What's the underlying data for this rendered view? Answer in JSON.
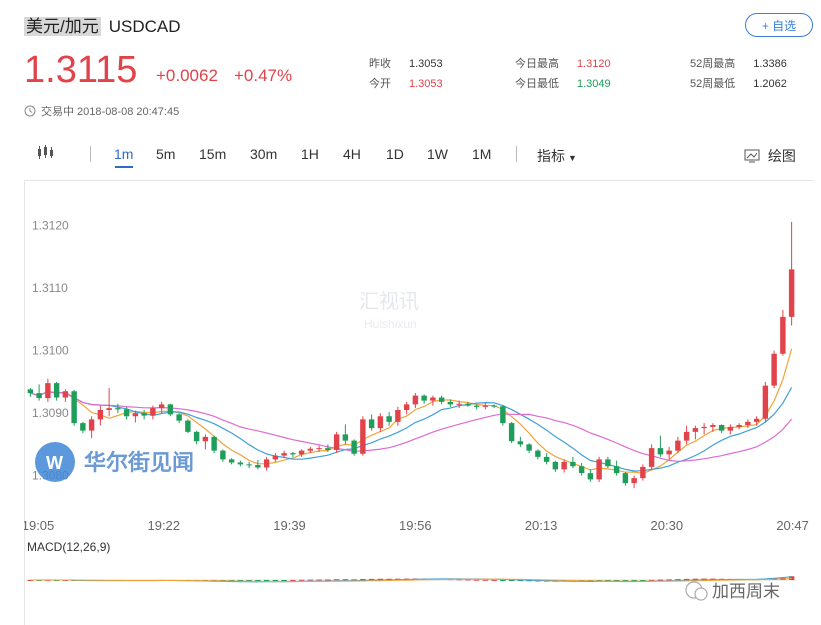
{
  "header": {
    "name_cn": "美元/加元",
    "symbol": "USDCAD",
    "add_button": "+ 自选",
    "price": "1.3115",
    "change": "+0.0062",
    "change_pct": "+0.47%",
    "status": "交易中 2018-08-08 20:47:45"
  },
  "stats": [
    {
      "label": "昨收",
      "value": "1.3053",
      "color": "dark"
    },
    {
      "label": "今开",
      "value": "1.3053",
      "color": "red"
    },
    {
      "label": "今日最高",
      "value": "1.3120",
      "color": "red"
    },
    {
      "label": "今日最低",
      "value": "1.3049",
      "color": "green"
    },
    {
      "label": "52周最高",
      "value": "1.3386",
      "color": "dark"
    },
    {
      "label": "52周最低",
      "value": "1.2062",
      "color": "dark"
    }
  ],
  "toolbar": {
    "tabs": [
      "1m",
      "5m",
      "15m",
      "30m",
      "1H",
      "4H",
      "1D",
      "1W",
      "1M"
    ],
    "active_tab": "1m",
    "indicator_label": "指标",
    "draw_label": "绘图"
  },
  "colors": {
    "up": "#e0434a",
    "down": "#1e9e5a",
    "accent": "#2f6bc2"
  },
  "chart_data": {
    "type": "candlestick",
    "y_ticks": [
      "1.3120",
      "1.3110",
      "1.3100",
      "1.3090",
      "1.3080"
    ],
    "ylim": [
      1.30745,
      1.31265
    ],
    "x_ticks": [
      "19:05",
      "19:22",
      "19:39",
      "19:56",
      "20:13",
      "20:30",
      "20:47"
    ],
    "candles": [
      [
        1.30938,
        1.3094,
        1.30926,
        1.30932
      ],
      [
        1.30932,
        1.30946,
        1.3092,
        1.30924
      ],
      [
        1.30924,
        1.30955,
        1.30918,
        1.30948
      ],
      [
        1.30948,
        1.3095,
        1.3092,
        1.30925
      ],
      [
        1.30925,
        1.30938,
        1.30918,
        1.30935
      ],
      [
        1.30935,
        1.30937,
        1.3088,
        1.30884
      ],
      [
        1.30884,
        1.30886,
        1.30868,
        1.30872
      ],
      [
        1.30872,
        1.30895,
        1.3086,
        1.3089
      ],
      [
        1.3089,
        1.30912,
        1.3088,
        1.30905
      ],
      [
        1.30905,
        1.3094,
        1.30895,
        1.30908
      ],
      [
        1.30908,
        1.30915,
        1.309,
        1.30906
      ],
      [
        1.30906,
        1.3091,
        1.3089,
        1.30895
      ],
      [
        1.30895,
        1.30904,
        1.30885,
        1.309
      ],
      [
        1.309,
        1.30905,
        1.3089,
        1.30896
      ],
      [
        1.30896,
        1.30912,
        1.3089,
        1.30908
      ],
      [
        1.30908,
        1.30918,
        1.309,
        1.30914
      ],
      [
        1.30914,
        1.30915,
        1.30895,
        1.30898
      ],
      [
        1.30898,
        1.309,
        1.30884,
        1.30888
      ],
      [
        1.30888,
        1.3089,
        1.30868,
        1.3087
      ],
      [
        1.3087,
        1.30872,
        1.3085,
        1.30855
      ],
      [
        1.30855,
        1.30866,
        1.30842,
        1.30862
      ],
      [
        1.30862,
        1.30864,
        1.30836,
        1.3084
      ],
      [
        1.3084,
        1.30842,
        1.30822,
        1.30826
      ],
      [
        1.30826,
        1.30828,
        1.30818,
        1.30821
      ],
      [
        1.30821,
        1.30824,
        1.30815,
        1.30818
      ],
      [
        1.30818,
        1.30822,
        1.30812,
        1.30817
      ],
      [
        1.30817,
        1.30825,
        1.3081,
        1.30813
      ],
      [
        1.30813,
        1.3083,
        1.30808,
        1.30826
      ],
      [
        1.30826,
        1.30836,
        1.30822,
        1.30832
      ],
      [
        1.30832,
        1.3084,
        1.30828,
        1.30836
      ],
      [
        1.30836,
        1.30838,
        1.3083,
        1.30834
      ],
      [
        1.30834,
        1.30842,
        1.3083,
        1.3084
      ],
      [
        1.3084,
        1.30846,
        1.30836,
        1.30843
      ],
      [
        1.30843,
        1.30848,
        1.30838,
        1.30844
      ],
      [
        1.30844,
        1.3085,
        1.30838,
        1.30841
      ],
      [
        1.30841,
        1.3087,
        1.30836,
        1.30866
      ],
      [
        1.30866,
        1.30882,
        1.3085,
        1.30856
      ],
      [
        1.30856,
        1.30858,
        1.30832,
        1.30835
      ],
      [
        1.30835,
        1.30895,
        1.30832,
        1.3089
      ],
      [
        1.3089,
        1.30898,
        1.30872,
        1.30876
      ],
      [
        1.30876,
        1.309,
        1.3087,
        1.30895
      ],
      [
        1.30895,
        1.30902,
        1.3088,
        1.30886
      ],
      [
        1.30886,
        1.3091,
        1.3088,
        1.30905
      ],
      [
        1.30905,
        1.30918,
        1.30898,
        1.30914
      ],
      [
        1.30914,
        1.30932,
        1.30908,
        1.30928
      ],
      [
        1.30928,
        1.3093,
        1.30915,
        1.3092
      ],
      [
        1.3092,
        1.30928,
        1.30912,
        1.30925
      ],
      [
        1.30925,
        1.30928,
        1.30914,
        1.30918
      ],
      [
        1.30918,
        1.30922,
        1.3091,
        1.30914
      ],
      [
        1.30914,
        1.3092,
        1.30908,
        1.30915
      ],
      [
        1.30915,
        1.30918,
        1.3091,
        1.30912
      ],
      [
        1.30912,
        1.30914,
        1.30906,
        1.3091
      ],
      [
        1.3091,
        1.30916,
        1.30906,
        1.30912
      ],
      [
        1.30912,
        1.30914,
        1.30908,
        1.30911
      ],
      [
        1.30911,
        1.30912,
        1.3088,
        1.30884
      ],
      [
        1.30884,
        1.30886,
        1.30852,
        1.30855
      ],
      [
        1.30855,
        1.30862,
        1.30846,
        1.3085
      ],
      [
        1.3085,
        1.30852,
        1.30836,
        1.3084
      ],
      [
        1.3084,
        1.30842,
        1.30826,
        1.3083
      ],
      [
        1.3083,
        1.30836,
        1.30818,
        1.30822
      ],
      [
        1.30822,
        1.30824,
        1.30806,
        1.3081
      ],
      [
        1.3081,
        1.30826,
        1.30805,
        1.30822
      ],
      [
        1.30822,
        1.3083,
        1.30812,
        1.30815
      ],
      [
        1.30815,
        1.3082,
        1.308,
        1.30804
      ],
      [
        1.30804,
        1.3081,
        1.3079,
        1.30794
      ],
      [
        1.30794,
        1.3083,
        1.3079,
        1.30826
      ],
      [
        1.30826,
        1.3083,
        1.30812,
        1.30815
      ],
      [
        1.30815,
        1.30824,
        1.308,
        1.30804
      ],
      [
        1.30804,
        1.30806,
        1.30784,
        1.30788
      ],
      [
        1.30788,
        1.308,
        1.3078,
        1.30796
      ],
      [
        1.30796,
        1.30818,
        1.30792,
        1.30814
      ],
      [
        1.30814,
        1.3085,
        1.3081,
        1.30844
      ],
      [
        1.30844,
        1.30864,
        1.3083,
        1.30834
      ],
      [
        1.30834,
        1.30846,
        1.30826,
        1.3084
      ],
      [
        1.3084,
        1.30862,
        1.30836,
        1.30856
      ],
      [
        1.30856,
        1.3088,
        1.3085,
        1.3087
      ],
      [
        1.3087,
        1.3088,
        1.30858,
        1.30876
      ],
      [
        1.30876,
        1.30884,
        1.30866,
        1.30878
      ],
      [
        1.30878,
        1.30884,
        1.3087,
        1.30881
      ],
      [
        1.30881,
        1.30882,
        1.30868,
        1.30872
      ],
      [
        1.30872,
        1.30882,
        1.30866,
        1.30878
      ],
      [
        1.30878,
        1.30884,
        1.30874,
        1.30881
      ],
      [
        1.30881,
        1.3089,
        1.30876,
        1.30886
      ],
      [
        1.30886,
        1.30895,
        1.3088,
        1.30891
      ],
      [
        1.30891,
        1.3095,
        1.30886,
        1.30944
      ],
      [
        1.30944,
        1.31,
        1.3094,
        1.30995
      ],
      [
        1.30995,
        1.31065,
        1.30992,
        1.31054
      ],
      [
        1.31054,
        1.31206,
        1.3104,
        1.3113
      ]
    ]
  },
  "macd": {
    "label": "MACD(12,26,9)"
  },
  "watermarks": {
    "center_cn": "汇视讯",
    "center_en": "Huishixun",
    "left_brand": "华尔街见闻",
    "right_brand": "加西周末"
  }
}
